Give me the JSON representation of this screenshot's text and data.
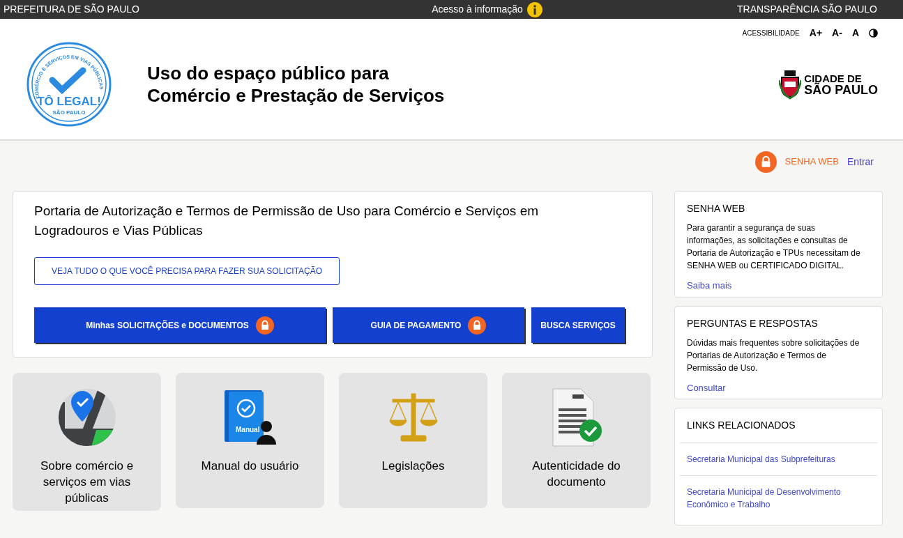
{
  "top_bar": {
    "left": "PREFEITURA DE SÃO PAULO",
    "center": "Acesso à informação",
    "right": "TRANSPARÊNCIA SÃO PAULO"
  },
  "accessibility": {
    "label": "ACESSIBILIDADE",
    "controls": [
      "A+",
      "A-",
      "A"
    ]
  },
  "logo": {
    "arc_text": "COMÉRCIO E SERVIÇOS EM VIAS PÚBLICAS",
    "name": "TÔ LEGAL!",
    "city": "SÃO PAULO"
  },
  "header": {
    "title_lines": [
      "Uso do espaço público para",
      "Comércio e Prestação de Serviços"
    ],
    "city_logo": [
      "CIDADE DE",
      "SÃO PAULO"
    ]
  },
  "login": {
    "label": "SENHA WEB",
    "link": "Entrar"
  },
  "main_card": {
    "title": "Portaria de Autorização e Termos de Permissão de Uso para Comércio e Serviços em Logradouros e Vias Públicas",
    "outline_button": "VEJA TUDO O QUE VOCÊ PRECISA PARA FAZER SUA SOLICITAÇÃO",
    "buttons": [
      {
        "label": "Minhas SOLICITAÇÕES e DOCUMENTOS",
        "locked": true
      },
      {
        "label": "GUIA DE PAGAMENTO",
        "locked": true
      },
      {
        "label": "BUSCA SERVIÇOS",
        "locked": false
      }
    ]
  },
  "tiles": [
    {
      "kind": "map",
      "label": "Sobre comércio e serviços em vias públicas"
    },
    {
      "kind": "manual",
      "label": "Manual do usuário",
      "icon_text": "Manual"
    },
    {
      "kind": "scale",
      "label": "Legislações"
    },
    {
      "kind": "document",
      "label": "Autenticidade do documento"
    }
  ],
  "sidebar": [
    {
      "kind": "info",
      "title": "SENHA WEB",
      "text": "Para garantir a segurança de suas informações, as solicitações e consultas de Portaria de Autorização e TPUs necessitam de SENHA WEB ou CERTIFICADO DIGITAL.",
      "link": "Saiba mais"
    },
    {
      "kind": "info",
      "title": "PERGUNTAS E RESPOSTAS",
      "text": "Dúvidas mais frequentes sobre solicitações de Portarias de Autorização e Termos de Permissão de Uso.",
      "link": "Consultar"
    },
    {
      "kind": "links",
      "title": "LINKS RELACIONADOS",
      "links": [
        "Secretaria Municipal das Subprefeituras",
        "Secretaria Municipal de Desenvolvimento Econômico e Trabalho"
      ]
    }
  ]
}
